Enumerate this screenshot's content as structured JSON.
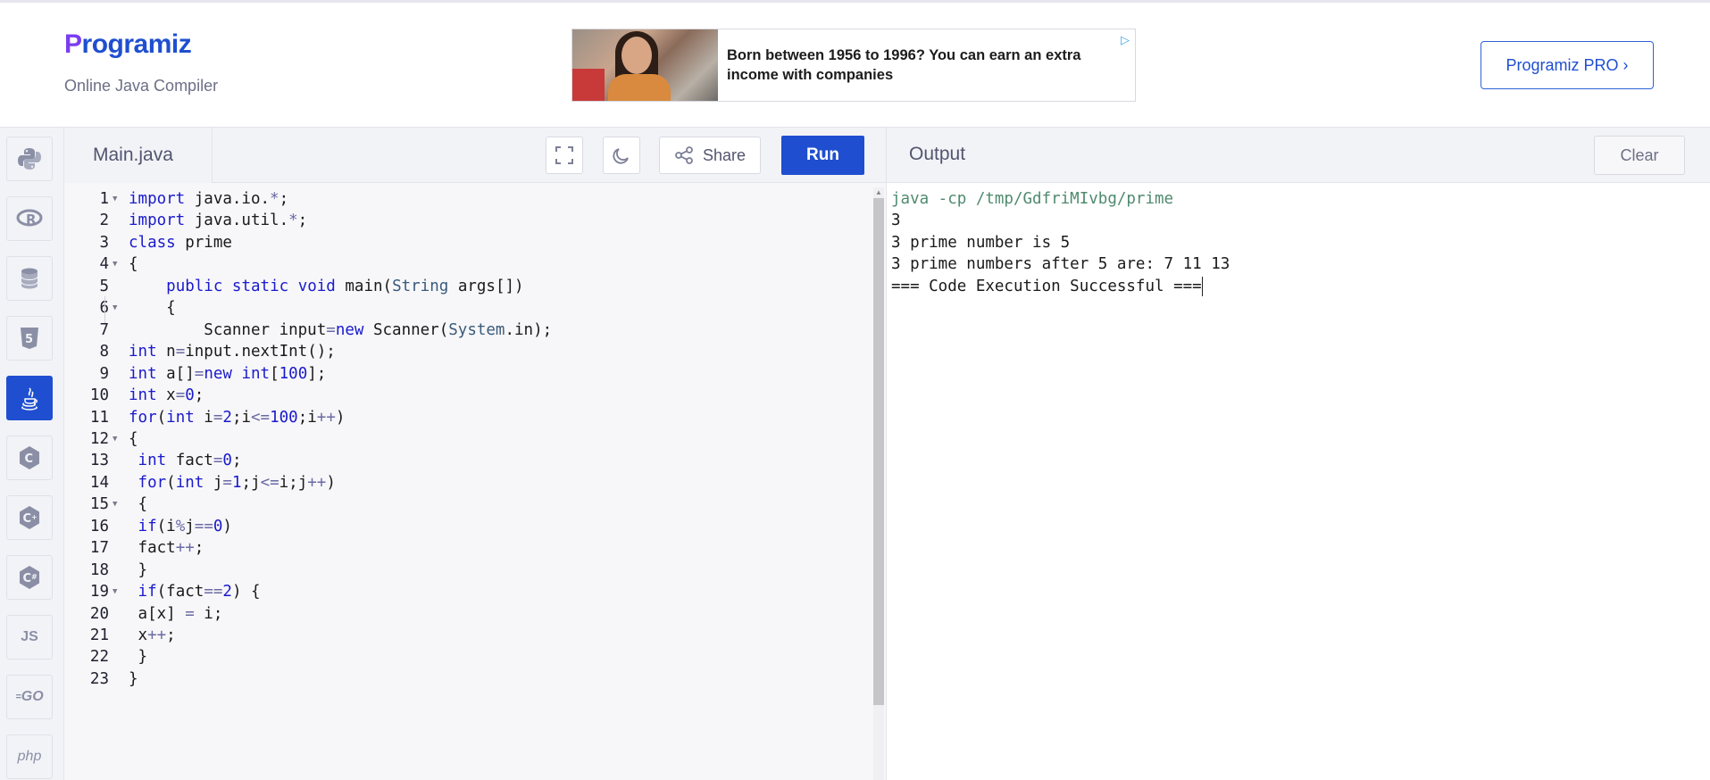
{
  "header": {
    "logo_text": "Programiz",
    "subtitle": "Online Java Compiler",
    "ad_text": "Born between 1956 to 1996? You can earn an extra income with companies",
    "pro_button": "Programiz PRO ›"
  },
  "rail": {
    "items": [
      {
        "name": "python",
        "label": ""
      },
      {
        "name": "r",
        "label": ""
      },
      {
        "name": "sql",
        "label": ""
      },
      {
        "name": "html",
        "label": ""
      },
      {
        "name": "java",
        "label": "",
        "active": true
      },
      {
        "name": "c",
        "label": ""
      },
      {
        "name": "cpp",
        "label": ""
      },
      {
        "name": "csharp",
        "label": ""
      },
      {
        "name": "js",
        "label": "JS"
      },
      {
        "name": "go",
        "label": "GO"
      },
      {
        "name": "php",
        "label": "php"
      }
    ]
  },
  "editor": {
    "file_tab": "Main.java",
    "share_label": "Share",
    "run_label": "Run",
    "lines": [
      {
        "n": "1",
        "fold": true,
        "text": "import java.io.*;"
      },
      {
        "n": "2",
        "fold": false,
        "text": "import java.util.*;"
      },
      {
        "n": "3",
        "fold": false,
        "text": "class prime"
      },
      {
        "n": "4",
        "fold": true,
        "text": "{"
      },
      {
        "n": "5",
        "fold": false,
        "text": "    public static void main(String args[])"
      },
      {
        "n": "6",
        "fold": true,
        "text": "    {"
      },
      {
        "n": "7",
        "fold": false,
        "text": "        Scanner input=new Scanner(System.in);"
      },
      {
        "n": "8",
        "fold": false,
        "text": "int n=input.nextInt();"
      },
      {
        "n": "9",
        "fold": false,
        "text": "int a[]=new int[100];"
      },
      {
        "n": "10",
        "fold": false,
        "text": "int x=0;"
      },
      {
        "n": "11",
        "fold": false,
        "text": "for(int i=2;i<=100;i++)"
      },
      {
        "n": "12",
        "fold": true,
        "text": "{"
      },
      {
        "n": "13",
        "fold": false,
        "text": " int fact=0;"
      },
      {
        "n": "14",
        "fold": false,
        "text": " for(int j=1;j<=i;j++)"
      },
      {
        "n": "15",
        "fold": true,
        "text": " {"
      },
      {
        "n": "16",
        "fold": false,
        "text": " if(i%j==0)"
      },
      {
        "n": "17",
        "fold": false,
        "text": " fact++;"
      },
      {
        "n": "18",
        "fold": false,
        "text": " }"
      },
      {
        "n": "19",
        "fold": true,
        "text": " if(fact==2) {"
      },
      {
        "n": "20",
        "fold": false,
        "text": " a[x] = i;"
      },
      {
        "n": "21",
        "fold": false,
        "text": " x++;"
      },
      {
        "n": "22",
        "fold": false,
        "text": " }"
      },
      {
        "n": "23",
        "fold": false,
        "text": "}"
      }
    ]
  },
  "output": {
    "title": "Output",
    "clear_label": "Clear",
    "lines": [
      "java -cp /tmp/GdfriMIvbg/prime",
      "3",
      "3 prime number is 5",
      "3 prime numbers after 5 are: 7 11 13",
      "=== Code Execution Successful ==="
    ]
  },
  "colors": {
    "accent": "#1f4fd0",
    "keyword": "#1a1acc",
    "command_output": "#4f8a6e"
  }
}
